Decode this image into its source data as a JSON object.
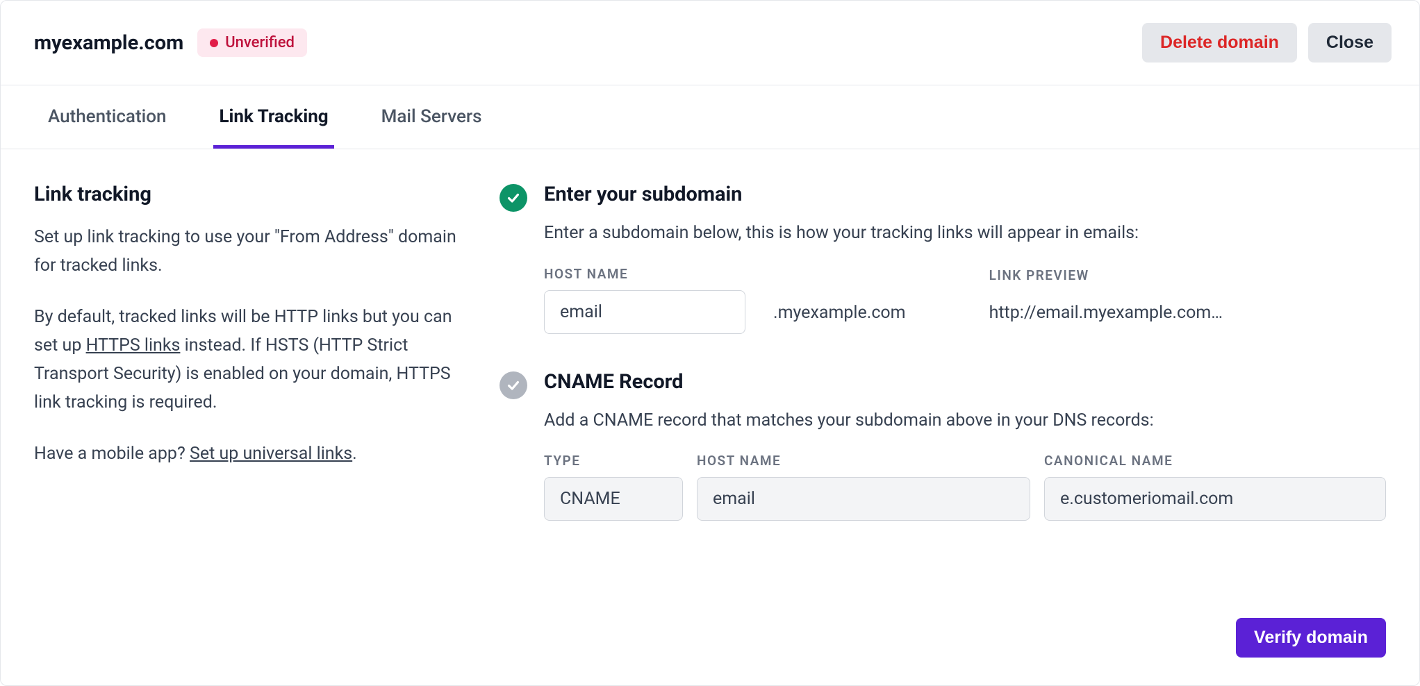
{
  "header": {
    "domain": "myexample.com",
    "badge_label": "Unverified",
    "delete_label": "Delete domain",
    "close_label": "Close"
  },
  "tabs": {
    "items": [
      {
        "label": "Authentication",
        "active": false
      },
      {
        "label": "Link Tracking",
        "active": true
      },
      {
        "label": "Mail Servers",
        "active": false
      }
    ]
  },
  "left": {
    "heading": "Link tracking",
    "p1": "Set up link tracking to use your \"From Address\" domain for tracked links.",
    "p2_pre": "By default, tracked links will be HTTP links but you can set up ",
    "p2_link": "HTTPS links",
    "p2_post": " instead. If HSTS (HTTP Strict Transport Security) is enabled on your domain, HTTPS link tracking is required.",
    "p3_pre": "Have a mobile app? ",
    "p3_link": "Set up universal links",
    "p3_post": "."
  },
  "subdomain": {
    "title": "Enter your subdomain",
    "desc": "Enter a subdomain below, this is how your tracking links will appear in emails:",
    "host_label": "HOST NAME",
    "host_value": "email",
    "suffix": ".myexample.com",
    "preview_label": "LINK PREVIEW",
    "preview_value": "http://email.myexample.com…"
  },
  "cname": {
    "title": "CNAME Record",
    "desc": "Add a CNAME record that matches your subdomain above in your DNS records:",
    "type_label": "TYPE",
    "type_value": "CNAME",
    "host_label": "HOST NAME",
    "host_value": "email",
    "canon_label": "CANONICAL NAME",
    "canon_value": "e.customeriomail.com"
  },
  "footer": {
    "verify_label": "Verify domain"
  }
}
